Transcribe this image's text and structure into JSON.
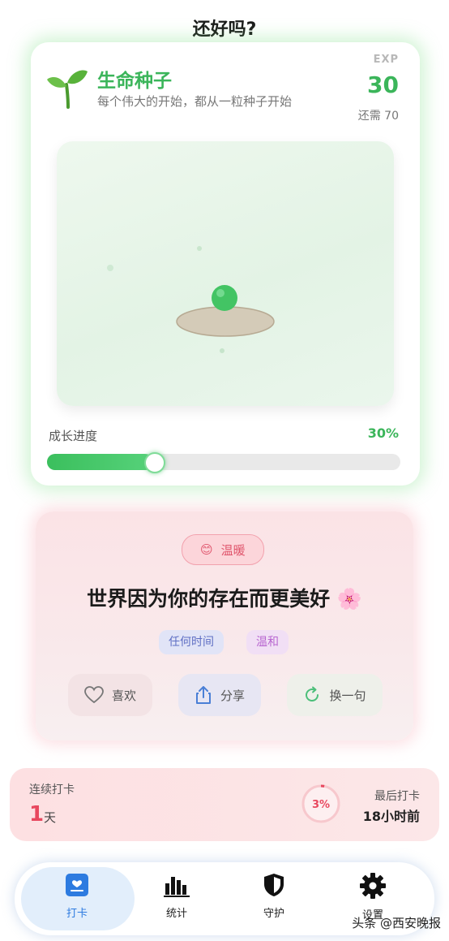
{
  "header": {
    "title": "还好吗?"
  },
  "seed": {
    "title": "生命种子",
    "subtitle": "每个伟大的开始，都从一粒种子开始",
    "exp_label": "EXP",
    "exp_value": "30",
    "exp_remaining": "还需 70",
    "growth_label": "成长进度",
    "growth_percent": "30%",
    "growth_fraction": 0.3
  },
  "quote": {
    "mood_emoji": "😊",
    "mood_label": "温暖",
    "text": "世界因为你的存在而更美好 🌸",
    "tags": [
      "任何时间",
      "温和"
    ],
    "actions": {
      "like": "喜欢",
      "share": "分享",
      "next": "换一句"
    }
  },
  "streak": {
    "label": "连续打卡",
    "count": "1",
    "unit": "天",
    "ring_percent": "3%",
    "ring_fraction": 0.03,
    "last_label": "最后打卡",
    "last_value": "18小时前"
  },
  "nav": {
    "items": [
      {
        "label": "打卡",
        "icon": "checkin-icon",
        "active": true
      },
      {
        "label": "统计",
        "icon": "stats-icon",
        "active": false
      },
      {
        "label": "守护",
        "icon": "shield-icon",
        "active": false
      },
      {
        "label": "设置",
        "icon": "gear-icon",
        "active": false
      }
    ]
  },
  "watermark": "头条 @西安晚报",
  "colors": {
    "accent_green": "#3bb55a",
    "accent_pink": "#e8485f",
    "nav_blue": "#2d7be0"
  }
}
